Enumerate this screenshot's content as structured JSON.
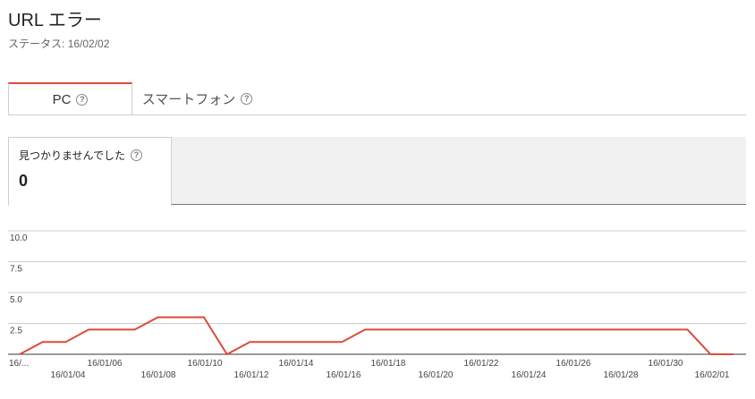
{
  "header": {
    "title": "URL エラー",
    "status_label": "ステータス:",
    "status_date": "16/02/02"
  },
  "tabs": [
    {
      "label": "PC",
      "active": true,
      "help_icon": "question-circle-icon"
    },
    {
      "label": "スマートフォン",
      "active": false,
      "help_icon": "question-circle-icon"
    }
  ],
  "metric": {
    "label": "見つかりませんでした",
    "value": "0",
    "help_icon": "question-circle-icon"
  },
  "colors": {
    "accent": "#dd4b39",
    "line": "#dd4b39",
    "grid": "#cccccc",
    "strip_bg": "#f1f1f1"
  },
  "chart_data": {
    "type": "line",
    "yticks": [
      "10.0",
      "7.5",
      "5.0",
      "2.5"
    ],
    "ylim": [
      0,
      10
    ],
    "x_labels_top": [
      "16/...",
      "16/01/06",
      "16/01/10",
      "16/01/14",
      "16/01/18",
      "16/01/22",
      "16/01/26",
      "16/01/30"
    ],
    "x_labels_bottom": [
      "16/01/04",
      "16/01/08",
      "16/01/12",
      "16/01/16",
      "16/01/20",
      "16/01/24",
      "16/01/28",
      "16/02/01"
    ],
    "x": [
      "16/01/02",
      "16/01/03",
      "16/01/04",
      "16/01/05",
      "16/01/06",
      "16/01/07",
      "16/01/08",
      "16/01/09",
      "16/01/10",
      "16/01/11",
      "16/01/12",
      "16/01/13",
      "16/01/14",
      "16/01/15",
      "16/01/16",
      "16/01/17",
      "16/01/18",
      "16/01/19",
      "16/01/20",
      "16/01/21",
      "16/01/22",
      "16/01/23",
      "16/01/24",
      "16/01/25",
      "16/01/26",
      "16/01/27",
      "16/01/28",
      "16/01/29",
      "16/01/30",
      "16/01/31",
      "16/02/01",
      "16/02/02"
    ],
    "series": [
      {
        "values": [
          0,
          1,
          1,
          2,
          2,
          2,
          3,
          3,
          3,
          0,
          1,
          1,
          1,
          1,
          1,
          2,
          2,
          2,
          2,
          2,
          2,
          2,
          2,
          2,
          2,
          2,
          2,
          2,
          2,
          2,
          0,
          0
        ]
      }
    ],
    "grid": true
  }
}
